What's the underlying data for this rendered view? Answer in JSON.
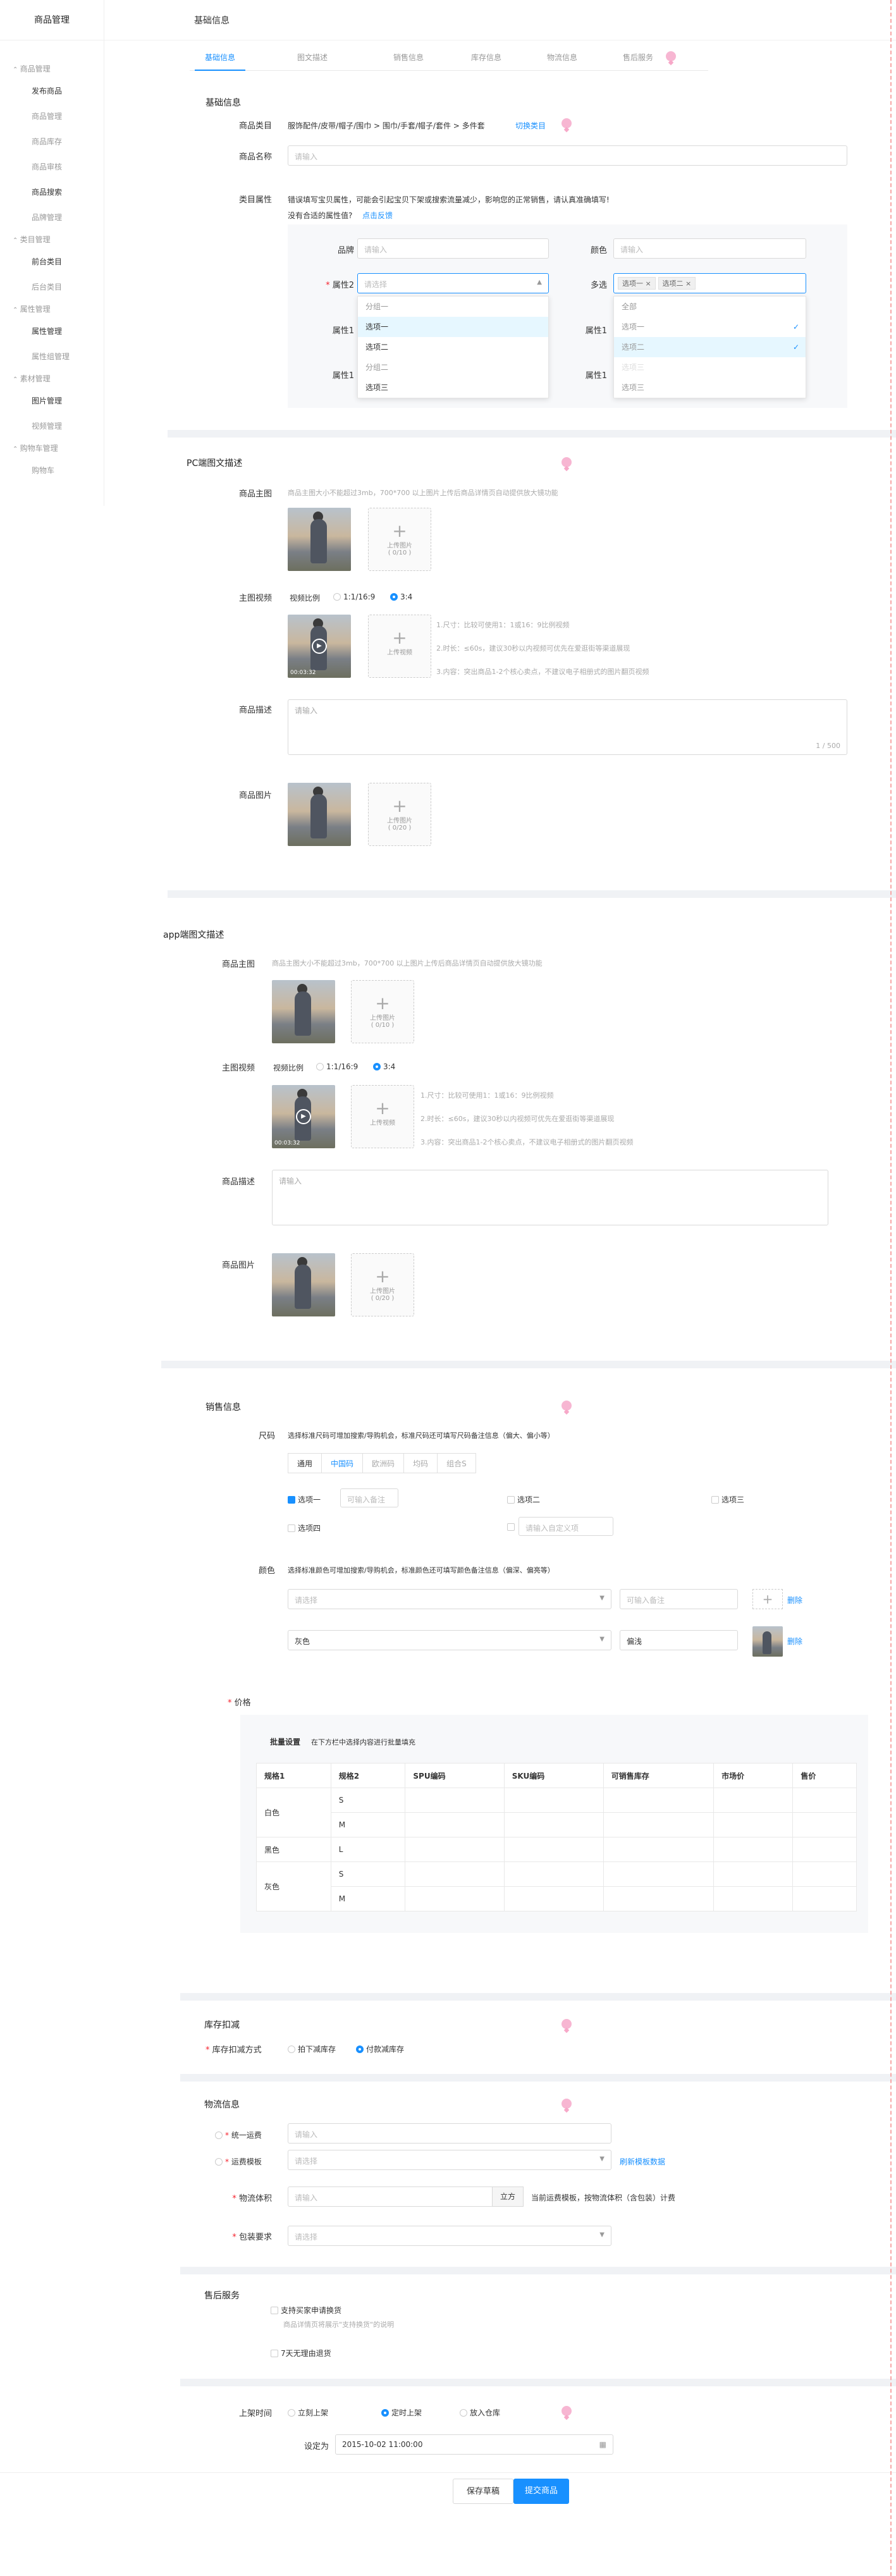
{
  "sidebar": {
    "brand": "商品管理",
    "groups": [
      {
        "title": "商品管理",
        "items": [
          "发布商品",
          "商品管理",
          "商品库存",
          "商品审核",
          "商品搜索",
          "品牌管理"
        ]
      },
      {
        "title": "类目管理",
        "items": [
          "前台类目",
          "后台类目"
        ]
      },
      {
        "title": "属性管理",
        "items": [
          "属性管理",
          "属性组管理"
        ]
      },
      {
        "title": "素材管理",
        "items": [
          "图片管理",
          "视频管理"
        ]
      },
      {
        "title": "购物车管理",
        "items": [
          "购物车"
        ]
      }
    ]
  },
  "header": {
    "title": "基础信息"
  },
  "tabs": [
    "基础信息",
    "图文描述",
    "销售信息",
    "库存信息",
    "物流信息",
    "售后服务"
  ],
  "basic": {
    "title": "基础信息",
    "category_label": "商品类目",
    "category_value": "服饰配件/皮带/帽子/围巾 > 围巾/手套/帽子/套件 > 多件套",
    "switch_category": "切换类目",
    "name_label": "商品名称",
    "name_placeholder": "请输入",
    "attr_label": "类目属性",
    "attr_hint": "错误填写宝贝属性，可能会引起宝贝下架或搜索流量减少，影响您的正常销售，请认真准确填写!",
    "attr_missing": "没有合适的属性值?",
    "attr_feedback": "点击反馈",
    "brand_label": "品牌",
    "brand_placeholder": "请输入",
    "color_label": "颜色",
    "color_placeholder": "请输入",
    "attr2_label": "属性2",
    "attr2_placeholder": "请选择",
    "multi_label": "多选",
    "multi_tags": [
      "选项一",
      "选项二"
    ],
    "attr1_label": "属性1",
    "dd1": [
      "分组一",
      "选项一",
      "选项二",
      "分组二",
      "选项三"
    ],
    "dd2": [
      "全部",
      "选项一",
      "选项二",
      "选项三",
      "选项三"
    ]
  },
  "pc": {
    "title": "PC端图文描述",
    "main_label": "商品主图",
    "main_hint": "商品主图大小不能超过3mb，700*700 以上图片上传后商品详情页自动提供放大镜功能",
    "upload_text": "上传图片",
    "upload_count": "( 0/10 )",
    "video_label": "主图视频",
    "ratio_label": "视频比例",
    "ratio_a": "1:1/16:9",
    "ratio_b": "3:4",
    "video_upload": "上传视频",
    "video_time": "00:03:32",
    "video_tips": [
      "1.尺寸：比较可使用1：1或16：9比例视频",
      "2.时长：≤60s，建议30秒以内视频可优先在爱逛街等渠道展现",
      "3.内容：突出商品1-2个核心卖点，不建议电子相册式的图片翻页视频"
    ],
    "desc_label": "商品描述",
    "desc_placeholder": "请输入",
    "desc_count": "1 / 500",
    "img_label": "商品图片",
    "img_count": "( 0/20 )"
  },
  "app": {
    "title": "app端图文描述",
    "main_hint": "商品主图大小不能超过3mb，700*700 以上图片上传后商品详情页自动提供放大镜功能",
    "upload_count": "( 0/10 )",
    "img_count": "( 0/20 )"
  },
  "sales": {
    "title": "销售信息",
    "size_label": "尺码",
    "size_hint": "选择标准尺码可增加搜索/导购机会，标准尺码还可填写尺码备注信息（偏大、偏小等）",
    "size_tabs": [
      "通用",
      "中国码",
      "欧洲码",
      "均码",
      "组合S"
    ],
    "options": [
      "选项一",
      "选项二",
      "选项三",
      "选项四"
    ],
    "opt_placeholder": "可输入备注",
    "custom_placeholder": "请输入自定义项",
    "color_label": "颜色",
    "color_hint": "选择标准颜色可增加搜索/导购机会，标准颜色还可填写颜色备注信息（偏深、偏亮等）",
    "color_select_placeholder": "请选择",
    "color_note_placeholder": "可输入备注",
    "color_value": "灰色",
    "color_note_value": "偏浅",
    "delete": "删除",
    "price_label": "价格",
    "batch_label": "批量设置",
    "batch_hint": "在下方栏中选择内容进行批量填充",
    "table_headers": [
      "规格1",
      "规格2",
      "SPU编码",
      "SKU编码",
      "可销售库存",
      "市场价",
      "售价"
    ],
    "rows": [
      {
        "spec1": "白色",
        "spec2": [
          "S",
          "M"
        ]
      },
      {
        "spec1": "黑色",
        "spec2": [
          "L"
        ]
      },
      {
        "spec1": "灰色",
        "spec2": [
          "S",
          "M"
        ]
      }
    ]
  },
  "stock": {
    "title": "库存扣减",
    "method_label": "库存扣减方式",
    "opt_a": "拍下减库存",
    "opt_b": "付款减库存"
  },
  "logistics": {
    "title": "物流信息",
    "freight_label": "统一运费",
    "freight_placeholder": "请输入",
    "template_label": "运费模板",
    "template_placeholder": "请选择",
    "refresh": "刷新模板数据",
    "volume_label": "物流体积",
    "volume_placeholder": "请输入",
    "volume_unit": "立方",
    "volume_hint": "当前运费模板，按物流体积（含包装）计费",
    "pack_label": "包装要求",
    "pack_placeholder": "请选择"
  },
  "aftersale": {
    "title": "售后服务",
    "opt1": "支持买家申请换货",
    "opt1_hint": "商品详情页将展示\"支持换货\"的说明",
    "opt2": "7天无理由退货"
  },
  "shelf": {
    "label": "上架时间",
    "opt_a": "立刻上架",
    "opt_b": "定时上架",
    "opt_c": "放入仓库",
    "set_label": "设定为",
    "datetime": "2015-10-02  11:00:00"
  },
  "actions": {
    "save": "保存草稿",
    "submit": "提交商品"
  },
  "colors": {
    "accent": "#1890ff",
    "danger": "#f5222d"
  }
}
